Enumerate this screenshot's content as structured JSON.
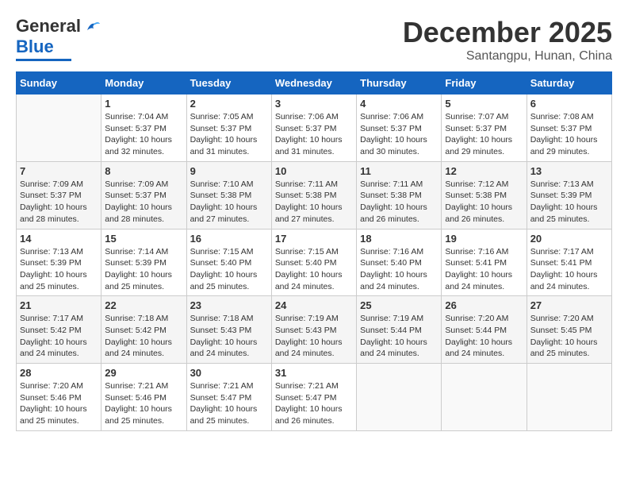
{
  "logo": {
    "line1": "General",
    "line2": "Blue"
  },
  "title": "December 2025",
  "subtitle": "Santangpu, Hunan, China",
  "days_of_week": [
    "Sunday",
    "Monday",
    "Tuesday",
    "Wednesday",
    "Thursday",
    "Friday",
    "Saturday"
  ],
  "weeks": [
    [
      {
        "day": "",
        "info": ""
      },
      {
        "day": "1",
        "info": "Sunrise: 7:04 AM\nSunset: 5:37 PM\nDaylight: 10 hours\nand 32 minutes."
      },
      {
        "day": "2",
        "info": "Sunrise: 7:05 AM\nSunset: 5:37 PM\nDaylight: 10 hours\nand 31 minutes."
      },
      {
        "day": "3",
        "info": "Sunrise: 7:06 AM\nSunset: 5:37 PM\nDaylight: 10 hours\nand 31 minutes."
      },
      {
        "day": "4",
        "info": "Sunrise: 7:06 AM\nSunset: 5:37 PM\nDaylight: 10 hours\nand 30 minutes."
      },
      {
        "day": "5",
        "info": "Sunrise: 7:07 AM\nSunset: 5:37 PM\nDaylight: 10 hours\nand 29 minutes."
      },
      {
        "day": "6",
        "info": "Sunrise: 7:08 AM\nSunset: 5:37 PM\nDaylight: 10 hours\nand 29 minutes."
      }
    ],
    [
      {
        "day": "7",
        "info": "Sunrise: 7:09 AM\nSunset: 5:37 PM\nDaylight: 10 hours\nand 28 minutes."
      },
      {
        "day": "8",
        "info": "Sunrise: 7:09 AM\nSunset: 5:37 PM\nDaylight: 10 hours\nand 28 minutes."
      },
      {
        "day": "9",
        "info": "Sunrise: 7:10 AM\nSunset: 5:38 PM\nDaylight: 10 hours\nand 27 minutes."
      },
      {
        "day": "10",
        "info": "Sunrise: 7:11 AM\nSunset: 5:38 PM\nDaylight: 10 hours\nand 27 minutes."
      },
      {
        "day": "11",
        "info": "Sunrise: 7:11 AM\nSunset: 5:38 PM\nDaylight: 10 hours\nand 26 minutes."
      },
      {
        "day": "12",
        "info": "Sunrise: 7:12 AM\nSunset: 5:38 PM\nDaylight: 10 hours\nand 26 minutes."
      },
      {
        "day": "13",
        "info": "Sunrise: 7:13 AM\nSunset: 5:39 PM\nDaylight: 10 hours\nand 25 minutes."
      }
    ],
    [
      {
        "day": "14",
        "info": "Sunrise: 7:13 AM\nSunset: 5:39 PM\nDaylight: 10 hours\nand 25 minutes."
      },
      {
        "day": "15",
        "info": "Sunrise: 7:14 AM\nSunset: 5:39 PM\nDaylight: 10 hours\nand 25 minutes."
      },
      {
        "day": "16",
        "info": "Sunrise: 7:15 AM\nSunset: 5:40 PM\nDaylight: 10 hours\nand 25 minutes."
      },
      {
        "day": "17",
        "info": "Sunrise: 7:15 AM\nSunset: 5:40 PM\nDaylight: 10 hours\nand 24 minutes."
      },
      {
        "day": "18",
        "info": "Sunrise: 7:16 AM\nSunset: 5:40 PM\nDaylight: 10 hours\nand 24 minutes."
      },
      {
        "day": "19",
        "info": "Sunrise: 7:16 AM\nSunset: 5:41 PM\nDaylight: 10 hours\nand 24 minutes."
      },
      {
        "day": "20",
        "info": "Sunrise: 7:17 AM\nSunset: 5:41 PM\nDaylight: 10 hours\nand 24 minutes."
      }
    ],
    [
      {
        "day": "21",
        "info": "Sunrise: 7:17 AM\nSunset: 5:42 PM\nDaylight: 10 hours\nand 24 minutes."
      },
      {
        "day": "22",
        "info": "Sunrise: 7:18 AM\nSunset: 5:42 PM\nDaylight: 10 hours\nand 24 minutes."
      },
      {
        "day": "23",
        "info": "Sunrise: 7:18 AM\nSunset: 5:43 PM\nDaylight: 10 hours\nand 24 minutes."
      },
      {
        "day": "24",
        "info": "Sunrise: 7:19 AM\nSunset: 5:43 PM\nDaylight: 10 hours\nand 24 minutes."
      },
      {
        "day": "25",
        "info": "Sunrise: 7:19 AM\nSunset: 5:44 PM\nDaylight: 10 hours\nand 24 minutes."
      },
      {
        "day": "26",
        "info": "Sunrise: 7:20 AM\nSunset: 5:44 PM\nDaylight: 10 hours\nand 24 minutes."
      },
      {
        "day": "27",
        "info": "Sunrise: 7:20 AM\nSunset: 5:45 PM\nDaylight: 10 hours\nand 25 minutes."
      }
    ],
    [
      {
        "day": "28",
        "info": "Sunrise: 7:20 AM\nSunset: 5:46 PM\nDaylight: 10 hours\nand 25 minutes."
      },
      {
        "day": "29",
        "info": "Sunrise: 7:21 AM\nSunset: 5:46 PM\nDaylight: 10 hours\nand 25 minutes."
      },
      {
        "day": "30",
        "info": "Sunrise: 7:21 AM\nSunset: 5:47 PM\nDaylight: 10 hours\nand 25 minutes."
      },
      {
        "day": "31",
        "info": "Sunrise: 7:21 AM\nSunset: 5:47 PM\nDaylight: 10 hours\nand 26 minutes."
      },
      {
        "day": "",
        "info": ""
      },
      {
        "day": "",
        "info": ""
      },
      {
        "day": "",
        "info": ""
      }
    ]
  ]
}
